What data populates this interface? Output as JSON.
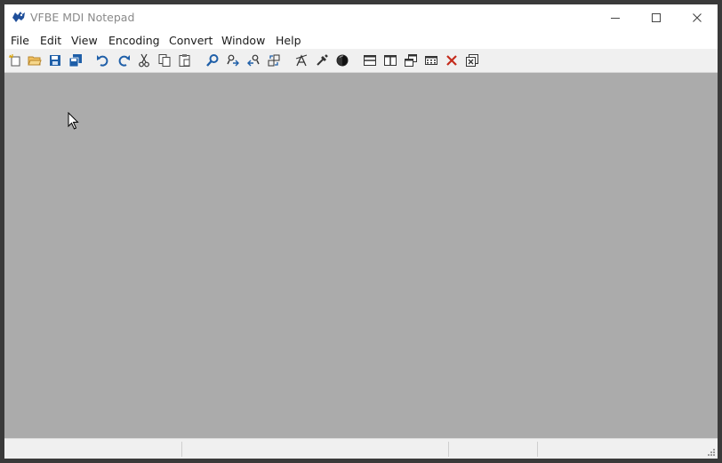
{
  "window": {
    "title": "VFBE MDI Notepad",
    "app_icon": "vfbe-app-icon",
    "controls": {
      "minimize": "minimize-icon",
      "maximize": "maximize-icon",
      "close": "close-icon"
    }
  },
  "menu": {
    "items": [
      {
        "label": "File"
      },
      {
        "label": "Edit"
      },
      {
        "label": "View"
      },
      {
        "label": "Encoding"
      },
      {
        "label": "Convert"
      },
      {
        "label": "Window"
      },
      {
        "label": "Help"
      }
    ]
  },
  "toolbar": {
    "buttons": [
      "new-file-icon",
      "open-folder-icon",
      "save-icon",
      "save-all-icon",
      "undo-icon",
      "redo-icon",
      "cut-icon",
      "copy-icon",
      "paste-icon",
      "find-icon",
      "find-next-icon",
      "find-previous-icon",
      "replace-icon",
      "font-icon",
      "color-picker-icon",
      "theme-circle-icon",
      "tile-horizontal-icon",
      "tile-vertical-icon",
      "cascade-icon",
      "arrange-icons-icon",
      "close-window-icon",
      "close-all-icon"
    ]
  },
  "statusbar": {
    "panes": [
      "",
      "",
      "",
      "",
      ""
    ]
  },
  "colors": {
    "mdi_background": "#ababab",
    "toolbar_background": "#f0f0f0",
    "icon_blue": "#1f5fa8",
    "close_red": "#c42b1c"
  }
}
